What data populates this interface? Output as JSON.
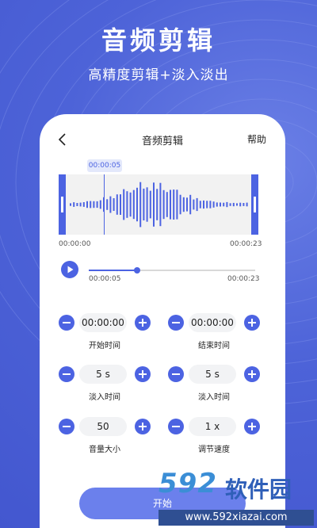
{
  "promo": {
    "title": "音频剪辑",
    "subtitle": "高精度剪辑+淡入淡出"
  },
  "nav": {
    "title": "音频剪辑",
    "help": "帮助",
    "back_icon": "chevron-left-icon"
  },
  "waveform": {
    "current_time": "00:00:05",
    "start_time": "00:00:00",
    "end_time": "00:00:23"
  },
  "player": {
    "position": "00:00:05",
    "duration": "00:00:23",
    "progress_fraction": 0.29
  },
  "controls": [
    {
      "value": "00:00:00",
      "label": "开始时间"
    },
    {
      "value": "00:00:00",
      "label": "结束时间"
    },
    {
      "value": "5 s",
      "label": "淡入时间"
    },
    {
      "value": "5 s",
      "label": "淡入时间"
    },
    {
      "value": "50",
      "label": "音量大小"
    },
    {
      "value": "1 x",
      "label": "调节速度"
    }
  ],
  "action": {
    "start_label": "开始"
  },
  "watermark": {
    "digits": "592",
    "name": "软件园",
    "url": "www.592xiazai.com"
  },
  "colors": {
    "accent": "#4c63e2",
    "background": "#4d63d8"
  }
}
